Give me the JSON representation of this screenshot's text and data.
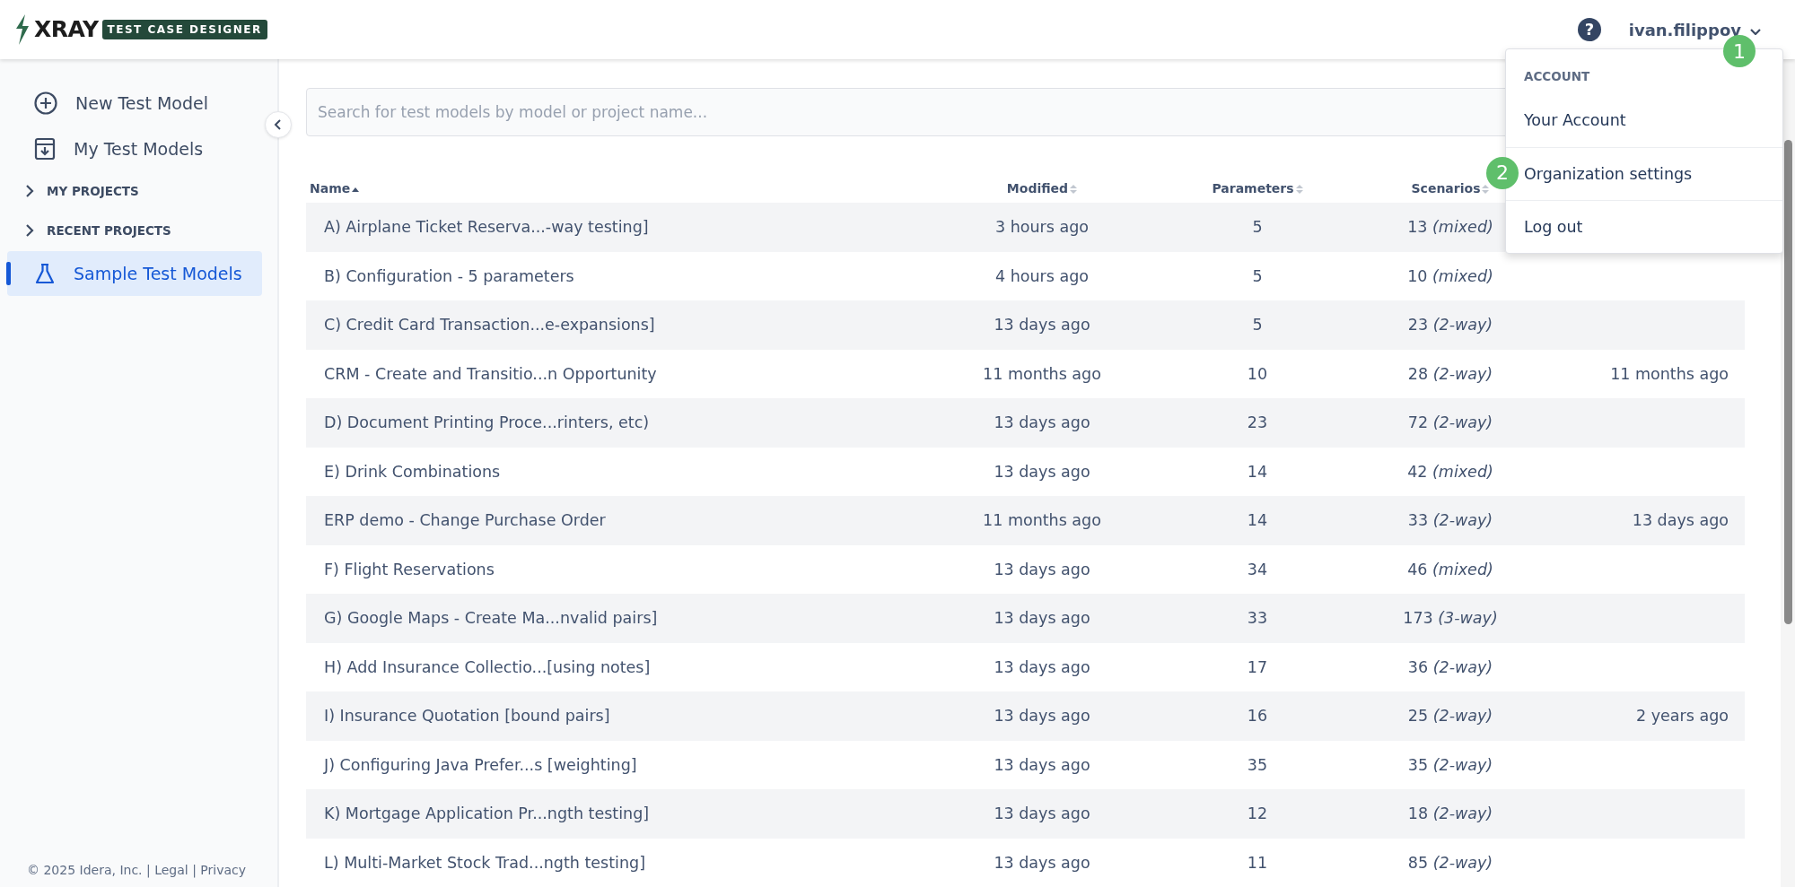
{
  "header": {
    "logo_word": "XRAY",
    "logo_tag": "TEST CASE DESIGNER",
    "help": "?",
    "user": "ivan.filippov"
  },
  "account_menu": {
    "heading": "ACCOUNT",
    "items": [
      {
        "label": "Your Account"
      },
      {
        "label": "Organization settings",
        "annotation": "2"
      },
      {
        "label": "Log out"
      }
    ],
    "user_annotation": "1"
  },
  "sidebar": {
    "items": [
      {
        "kind": "action",
        "label": "New Test Model",
        "selected": false
      },
      {
        "kind": "action",
        "label": "My Test Models",
        "selected": false
      },
      {
        "kind": "group",
        "label": "MY PROJECTS",
        "expanded": false
      },
      {
        "kind": "group",
        "label": "RECENT PROJECTS",
        "expanded": false
      },
      {
        "kind": "action",
        "label": "Sample Test Models",
        "selected": true
      }
    ],
    "footer": "© 2025 Idera, Inc. | Legal | Privacy"
  },
  "search": {
    "placeholder": "Search for test models by model or project name..."
  },
  "table": {
    "columns": [
      {
        "label": "Name",
        "sorted": true
      },
      {
        "label": "Modified",
        "sorted": false
      },
      {
        "label": "Parameters",
        "sorted": false
      },
      {
        "label": "Scenarios",
        "sorted": false
      }
    ],
    "rows": [
      {
        "name": "A) Airplane Ticket Reserva...-way testing]",
        "modified": "3 hours ago",
        "parameters": "5",
        "scenarios": "13 *(mixed)*"
      },
      {
        "name": "B) Configuration - 5 parameters",
        "modified": "4 hours ago",
        "parameters": "5",
        "scenarios": "10 *(mixed)*"
      },
      {
        "name": "C) Credit Card Transaction...e-expansions]",
        "modified": "13 days ago",
        "parameters": "5",
        "scenarios": "23 *(2-way)*"
      },
      {
        "name": "CRM - Create and Transitio...n Opportunity",
        "modified": "11 months ago",
        "parameters": "10",
        "scenarios": "28 *(2-way)*",
        "column_5": "11 months ago"
      },
      {
        "name": "D) Document Printing Proce...rinters, etc)",
        "modified": "13 days ago",
        "parameters": "23",
        "scenarios": "72 *(2-way)*"
      },
      {
        "name": "E) Drink Combinations",
        "modified": "13 days ago",
        "parameters": "14",
        "scenarios": "42 *(mixed)*"
      },
      {
        "name": "ERP demo - Change Purchase Order",
        "modified": "11 months ago",
        "parameters": "14",
        "scenarios": "33 *(2-way)*",
        "column_5": "13 days ago"
      },
      {
        "name": "F) Flight Reservations",
        "modified": "13 days ago",
        "parameters": "34",
        "scenarios": "46 *(mixed)*"
      },
      {
        "name": "G) Google Maps - Create Ma...nvalid pairs]",
        "modified": "13 days ago",
        "parameters": "33",
        "scenarios": "173 *(3-way)*"
      },
      {
        "name": "H) Add Insurance Collectio...[using notes]",
        "modified": "13 days ago",
        "parameters": "17",
        "scenarios": "36 *(2-way)*"
      },
      {
        "name": "I) Insurance Quotation [bound pairs]",
        "modified": "13 days ago",
        "parameters": "16",
        "scenarios": "25 *(2-way)*",
        "column_5": "2 years ago"
      },
      {
        "name": "J) Configuring Java Prefer...s [weighting]",
        "modified": "13 days ago",
        "parameters": "35",
        "scenarios": "35 *(2-way)*"
      },
      {
        "name": "K) Mortgage Application Pr...ngth testing]",
        "modified": "13 days ago",
        "parameters": "12",
        "scenarios": "18 *(2-way)*"
      },
      {
        "name": "L) Multi-Market Stock Trad...ngth testing]",
        "modified": "13 days ago",
        "parameters": "11",
        "scenarios": "85 *(2-way)*"
      }
    ]
  }
}
